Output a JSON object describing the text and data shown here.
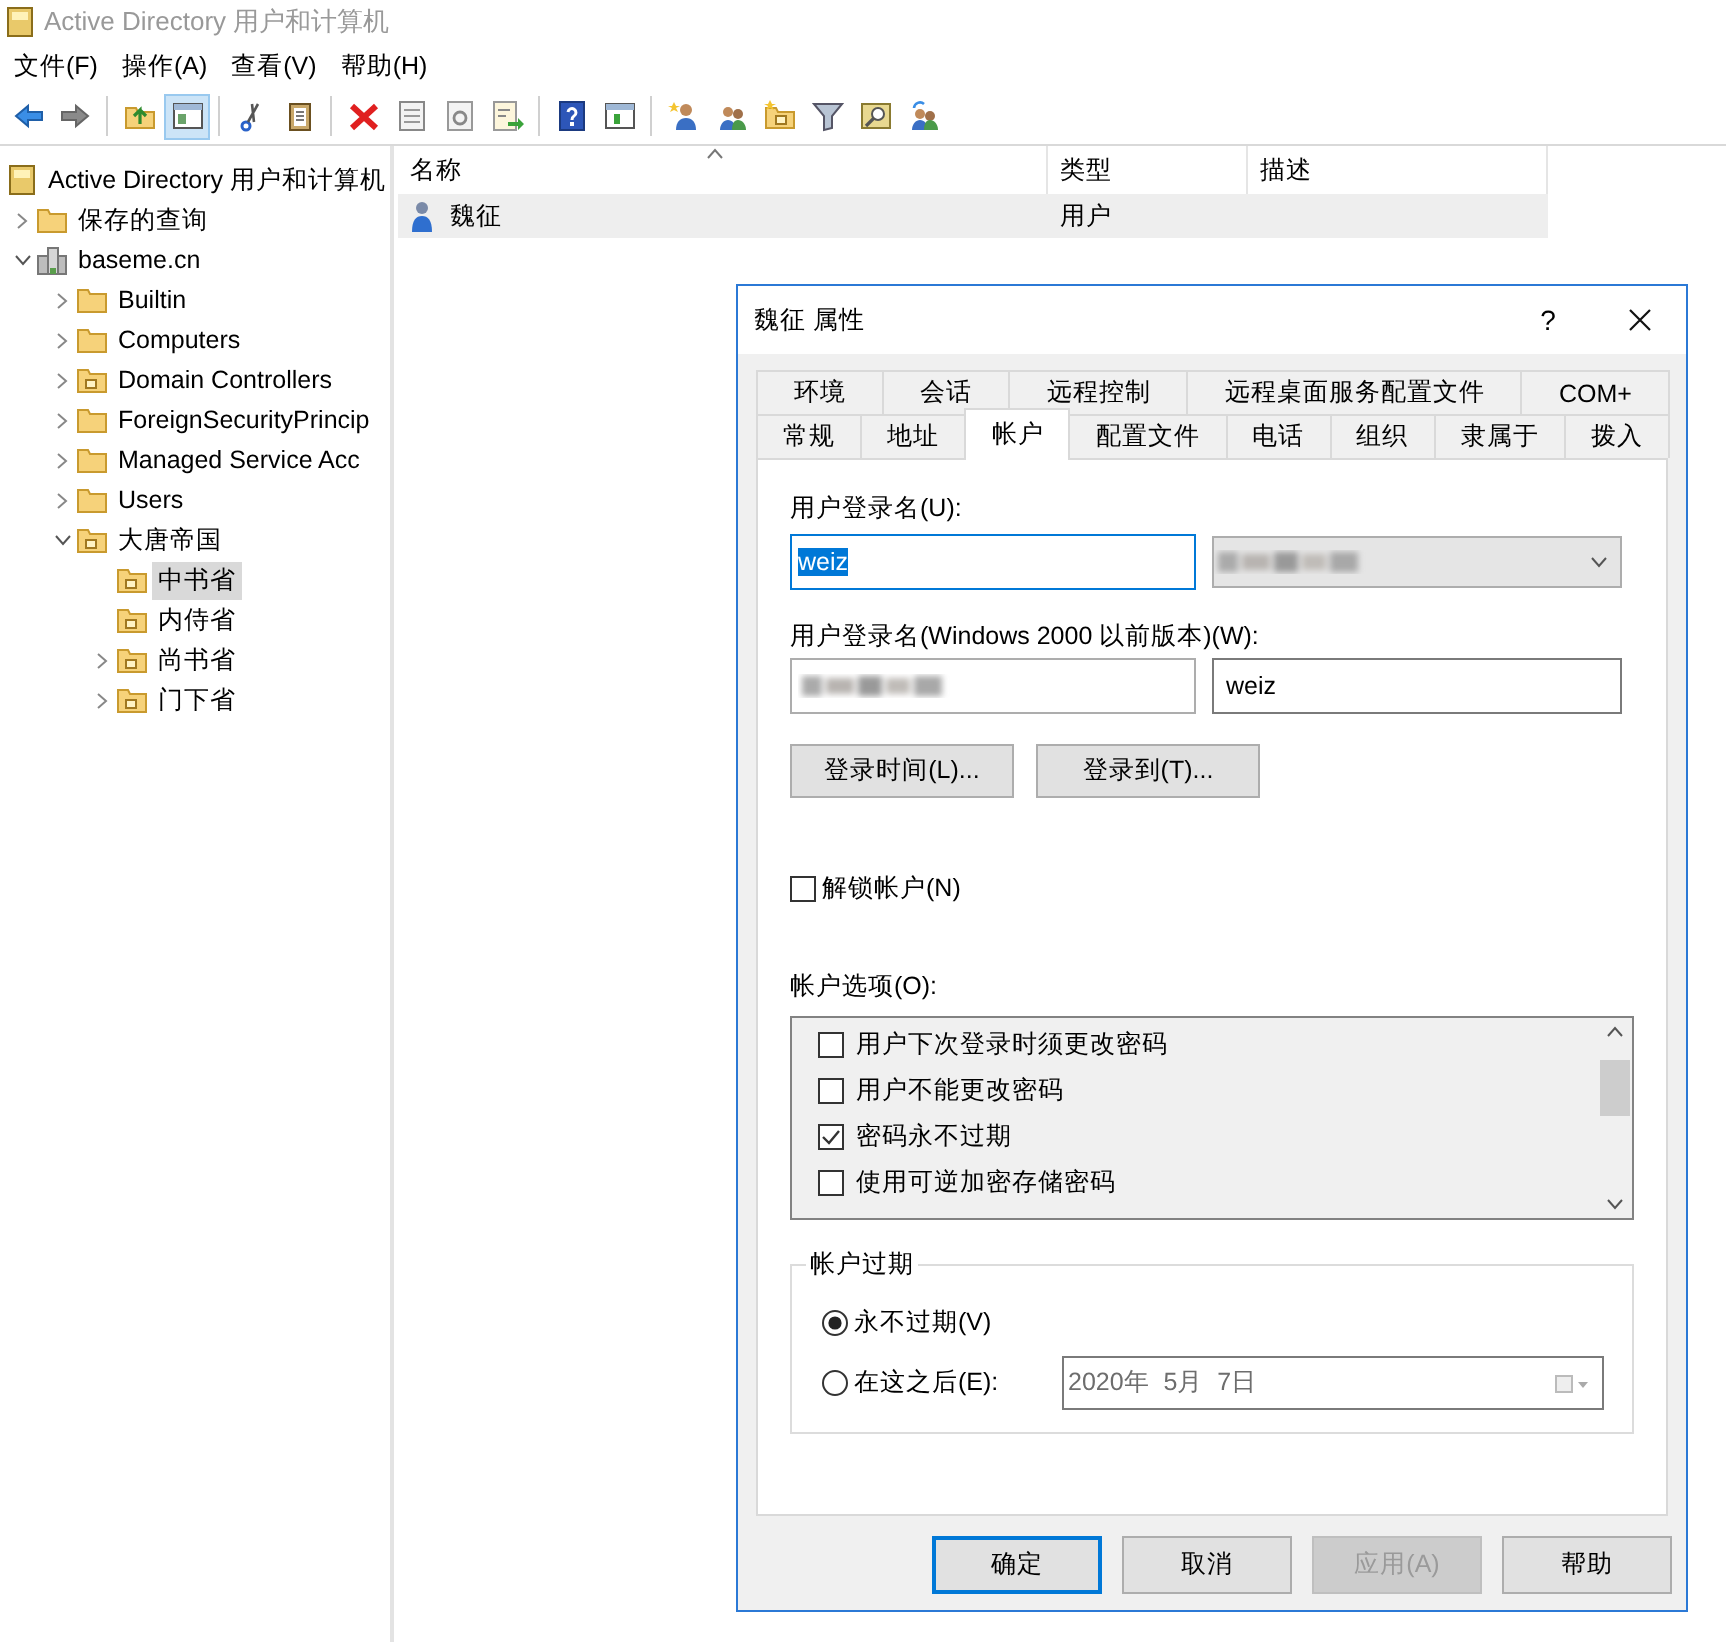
{
  "window": {
    "title": "Active Directory 用户和计算机"
  },
  "menu": [
    "文件(F)",
    "操作(A)",
    "查看(V)",
    "帮助(H)"
  ],
  "toolbar": [
    {
      "pressed": false
    },
    {
      "pressed": false
    },
    {
      "pressed": false
    },
    {
      "pressed": true
    },
    {
      "pressed": false
    },
    {
      "pressed": false
    },
    {
      "pressed": false
    },
    {
      "pressed": false
    },
    {
      "pressed": false
    },
    {
      "pressed": false
    },
    {
      "pressed": false
    },
    {
      "pressed": false
    },
    {
      "pressed": false
    },
    {
      "pressed": false
    },
    {
      "pressed": false
    },
    {
      "pressed": false
    },
    {
      "pressed": false
    },
    {
      "pressed": false
    }
  ],
  "tree": {
    "label": "Active Directory 用户和计算机",
    "kind": "snapin",
    "selected": false,
    "children": [
      {
        "label": "保存的查询",
        "kind": "folder",
        "expanded": false,
        "selected": false
      },
      {
        "label": "baseme.cn",
        "kind": "domain",
        "expanded": true,
        "selected": false,
        "children": [
          {
            "label": "Builtin",
            "kind": "folder",
            "expanded": false,
            "selected": false
          },
          {
            "label": "Computers",
            "kind": "folder",
            "expanded": false,
            "selected": false
          },
          {
            "label": "Domain Controllers",
            "kind": "ou",
            "expanded": false,
            "selected": false
          },
          {
            "label": "ForeignSecurityPrincip",
            "kind": "folder",
            "expanded": false,
            "selected": false
          },
          {
            "label": "Managed Service Acc",
            "kind": "folder",
            "expanded": false,
            "selected": false
          },
          {
            "label": "Users",
            "kind": "folder",
            "expanded": false,
            "selected": false
          },
          {
            "label": "大唐帝国",
            "kind": "ou",
            "expanded": true,
            "selected": false,
            "children": [
              {
                "label": "中书省",
                "kind": "ou",
                "selected": true
              },
              {
                "label": "内侍省",
                "kind": "ou",
                "selected": false
              },
              {
                "label": "尚书省",
                "kind": "ou",
                "expanded": false,
                "selected": false
              },
              {
                "label": "门下省",
                "kind": "ou",
                "expanded": false,
                "selected": false
              }
            ]
          }
        ]
      }
    ]
  },
  "list": {
    "columns": [
      "名称",
      "类型",
      "描述"
    ],
    "rows": [
      {
        "name": "魏征",
        "type": "用户",
        "selected": true
      }
    ]
  },
  "dialog": {
    "title": "魏征 属性",
    "help": "?",
    "tab_rows": [
      [
        {
          "label": "环境",
          "selected": false
        },
        {
          "label": "会话",
          "selected": false
        },
        {
          "label": "远程控制",
          "selected": false
        },
        {
          "label": "远程桌面服务配置文件",
          "selected": false
        },
        {
          "label": "COM+",
          "selected": false
        }
      ],
      [
        {
          "label": "常规",
          "selected": false
        },
        {
          "label": "地址",
          "selected": false
        },
        {
          "label": "帐户",
          "selected": true
        },
        {
          "label": "配置文件",
          "selected": false
        },
        {
          "label": "电话",
          "selected": false
        },
        {
          "label": "组织",
          "selected": false
        },
        {
          "label": "隶属于",
          "selected": false
        },
        {
          "label": "拨入",
          "selected": false
        }
      ]
    ],
    "logon_label": "用户登录名(U):",
    "logon_value": "weiz",
    "logon_text_selected": true,
    "pre2000_label": "用户登录名(Windows 2000 以前版本)(W):",
    "pre2000_value": "weiz",
    "buttons": [
      "登录时间(L)...",
      "登录到(T)..."
    ],
    "unlock": {
      "label": "解锁帐户(N)",
      "checked": false
    },
    "options_label": "帐户选项(O):",
    "options": [
      {
        "label": "用户下次登录时须更改密码",
        "checked": false
      },
      {
        "label": "用户不能更改密码",
        "checked": false
      },
      {
        "label": "密码永不过期",
        "checked": true
      },
      {
        "label": "使用可逆加密存储密码",
        "checked": false
      }
    ],
    "expiry": {
      "title": "帐户过期",
      "choices": [
        {
          "label": "永不过期(V)",
          "selected": true
        },
        {
          "label": "在这之后(E):",
          "selected": false
        }
      ],
      "date": "2020年  5月  7日",
      "date_disabled": true
    },
    "footer": [
      {
        "label": "确定",
        "default": true,
        "disabled": false
      },
      {
        "label": "取消",
        "default": false,
        "disabled": false
      },
      {
        "label": "应用(A)",
        "default": false,
        "disabled": true
      },
      {
        "label": "帮助",
        "default": false,
        "disabled": false
      }
    ]
  }
}
